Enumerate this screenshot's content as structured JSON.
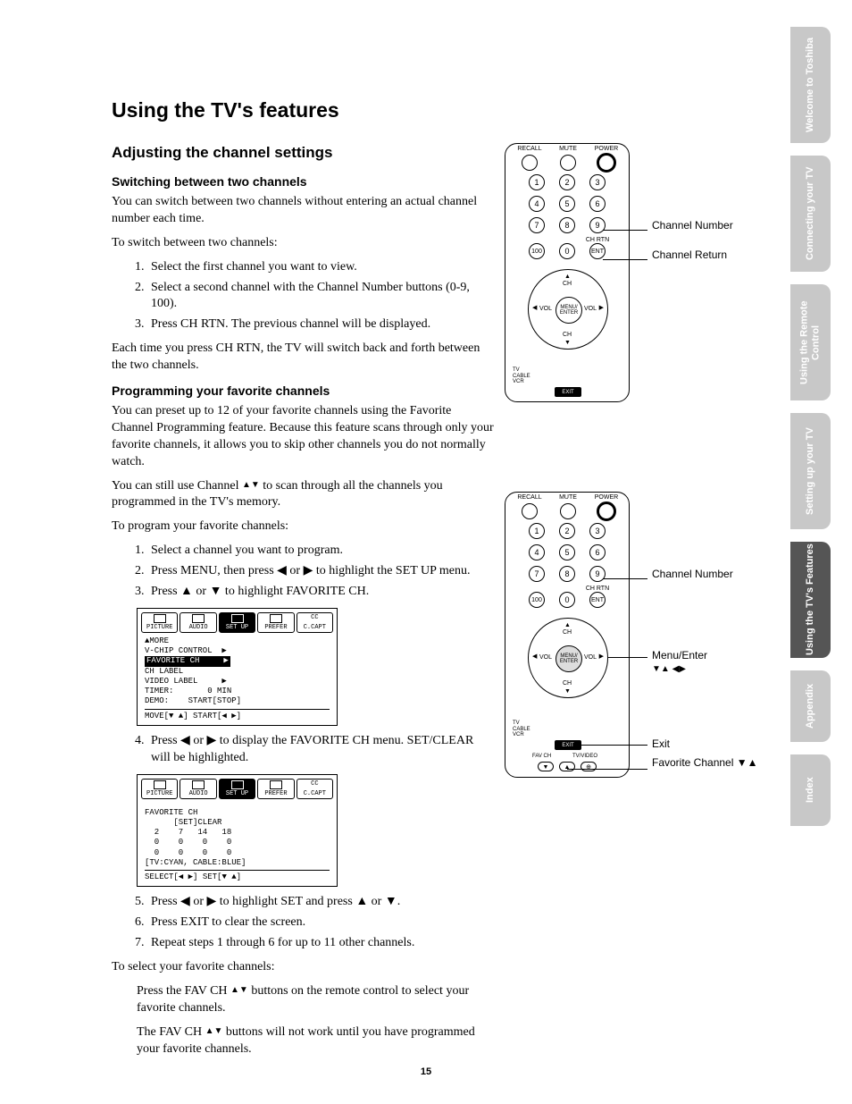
{
  "page_number": "15",
  "title": "Using the TV's features",
  "section": "Adjusting the channel settings",
  "sub1": {
    "heading": "Switching between two channels",
    "p1": "You can switch between two channels without entering an actual channel number each time.",
    "p2": "To switch between two channels:",
    "steps": [
      "Select the first channel you want to view.",
      "Select a second channel with the Channel Number buttons (0-9, 100).",
      "Press CH RTN. The previous channel will be displayed."
    ],
    "p3": "Each time you press CH RTN, the TV will switch back and forth between the two channels."
  },
  "sub2": {
    "heading": "Programming your favorite channels",
    "p1": "You can preset up to 12 of your favorite channels using the Favorite Channel Programming feature. Because this feature scans through only your favorite channels, it allows you to skip other channels you do not normally watch.",
    "p2_a": "You can still use Channel ",
    "p2_b": " to scan through all the channels you programmed in the TV's memory.",
    "p3": "To program your favorite channels:",
    "steps_a": [
      "Select a channel you want to program.",
      "Press MENU, then press ◀ or ▶ to highlight the SET UP menu.",
      "Press ▲ or ▼ to highlight FAVORITE CH."
    ],
    "step4": "Press ◀ or ▶ to display the FAVORITE CH menu. SET/CLEAR will be highlighted.",
    "steps_b": [
      "Press ◀ or ▶ to highlight SET and press ▲ or ▼.",
      "Press EXIT to clear the screen.",
      "Repeat steps 1 through 6 for up to 11 other channels."
    ],
    "p4": "To select your favorite channels:",
    "p5_a": "Press the FAV CH ",
    "p5_b": " buttons on the remote control to select your favorite channels.",
    "p6_a": "The FAV CH ",
    "p6_b": " buttons will not work until you have programmed your favorite channels."
  },
  "osd1": {
    "tabs": [
      "PICTURE",
      "AUDIO",
      "SET UP",
      "PREFER",
      "C.CAPT"
    ],
    "lines": [
      "▲MORE",
      "V-CHIP CONTROL  ▶",
      "FAVORITE CH     ▶",
      "CH LABEL",
      "VIDEO LABEL     ▶",
      "TIMER:       0 MIN",
      "DEMO:    START[STOP]"
    ],
    "highlight_index": 2,
    "hint": "MOVE[▼ ▲] START[◀ ▶]"
  },
  "osd2": {
    "tabs": [
      "PICTURE",
      "AUDIO",
      "SET UP",
      "PREFER",
      "C.CAPT"
    ],
    "title": "FAVORITE CH",
    "lines": [
      "      [SET]CLEAR",
      "  2    7   14   18",
      "  0    0    0    0",
      "  0    0    0    0",
      "[TV:CYAN, CABLE:BLUE]"
    ],
    "hint": "SELECT[◀ ▶] SET[▼ ▲]"
  },
  "remote": {
    "top_labels": [
      "RECALL",
      "MUTE",
      "POWER"
    ],
    "numbers": [
      [
        "1",
        "2",
        "3"
      ],
      [
        "4",
        "5",
        "6"
      ],
      [
        "7",
        "8",
        "9"
      ],
      [
        "100",
        "0",
        "ENT"
      ]
    ],
    "chrtn": "CH RTN",
    "dpad": {
      "center": "MENU/\nENTER",
      "up": "CH",
      "down": "CH",
      "left": "VOL",
      "right": "VOL"
    },
    "switch": [
      "TV",
      "CABLE",
      "VCR"
    ],
    "exit": "EXIT",
    "fav_labels": [
      "FAV CH",
      "TV/VIDEO"
    ]
  },
  "callouts1": {
    "ch_num": "Channel Number",
    "ch_rtn": "Channel Return"
  },
  "callouts2": {
    "ch_num": "Channel Number",
    "menu": "Menu/Enter",
    "menu_sym": "▼▲ ◀▶",
    "exit": "Exit",
    "fav": "Favorite Channel ▼▲"
  },
  "side_tabs": [
    "Welcome to Toshiba",
    "Connecting your TV",
    "Using the Remote Control",
    "Setting up your TV",
    "Using the TV's Features",
    "Appendix",
    "Index"
  ],
  "active_tab_index": 4
}
